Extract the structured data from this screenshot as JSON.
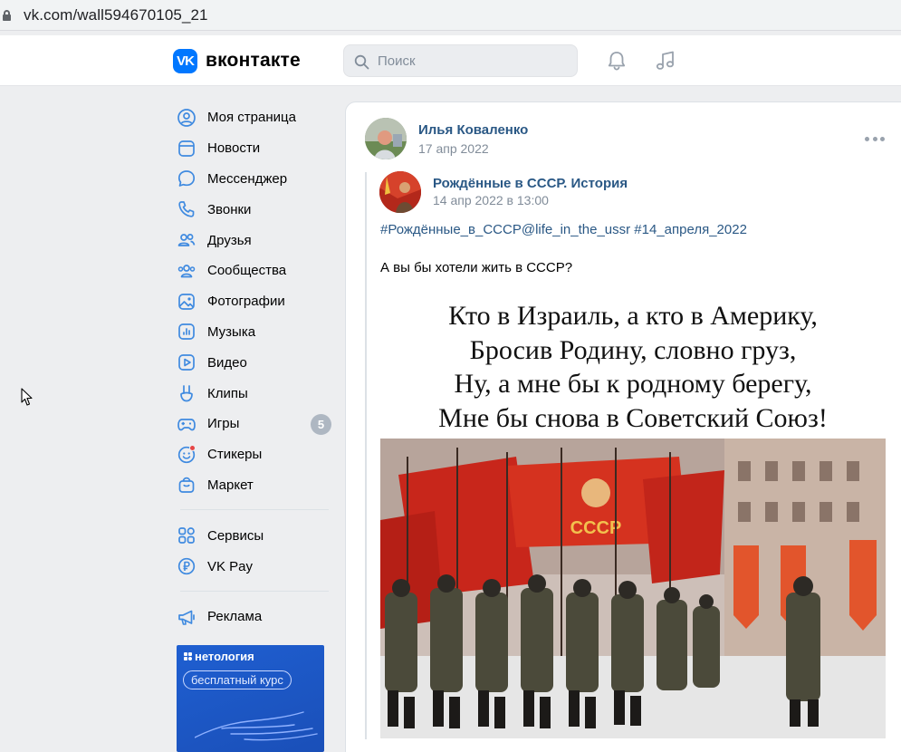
{
  "browser": {
    "url": "vk.com/wall594670105_21"
  },
  "header": {
    "logo_mark": "VK",
    "logo_text": "вконтакте",
    "search_placeholder": "Поиск",
    "icons": [
      "bell-icon",
      "music-note-icon"
    ]
  },
  "menu": {
    "items": [
      {
        "label": "Моя страница",
        "icon": "user-circle-icon"
      },
      {
        "label": "Новости",
        "icon": "news-icon"
      },
      {
        "label": "Мессенджер",
        "icon": "chat-bubble-icon"
      },
      {
        "label": "Звонки",
        "icon": "phone-icon"
      },
      {
        "label": "Друзья",
        "icon": "friends-icon"
      },
      {
        "label": "Сообщества",
        "icon": "communities-icon"
      },
      {
        "label": "Фотографии",
        "icon": "photo-icon"
      },
      {
        "label": "Музыка",
        "icon": "music-icon"
      },
      {
        "label": "Видео",
        "icon": "video-icon"
      },
      {
        "label": "Клипы",
        "icon": "clips-icon"
      },
      {
        "label": "Игры",
        "icon": "gamepad-icon",
        "badge": "5"
      },
      {
        "label": "Стикеры",
        "icon": "sticker-icon"
      },
      {
        "label": "Маркет",
        "icon": "market-bag-icon"
      }
    ],
    "services": [
      {
        "label": "Сервисы",
        "icon": "services-grid-icon"
      },
      {
        "label": "VK Pay",
        "icon": "vk-pay-icon"
      }
    ],
    "ads": {
      "label": "Реклама",
      "icon": "megaphone-icon"
    }
  },
  "ad_banner": {
    "brand": "нетология",
    "cta": "бесплатный курс"
  },
  "post": {
    "author": "Илья Коваленко",
    "date": "17 апр 2022",
    "repost": {
      "group": "Рождённые в СССР. История",
      "date": "14 апр 2022 в 13:00",
      "hashtags": "#Рождённые_в_СССР@life_in_the_ussr #14_апреля_2022",
      "text": "А вы бы хотели жить в СССР?",
      "image_text": [
        "Кто в Израиль, а кто в Америку,",
        "Бросив Родину, словно груз,",
        "Ну, а мне бы к родному берегу,",
        "Мне бы снова в Советский Союз!"
      ],
      "banner_text": "СССР"
    }
  },
  "colors": {
    "vk_blue": "#0077ff",
    "link": "#2a5885",
    "meta": "#818c99",
    "bg": "#edeef0"
  }
}
